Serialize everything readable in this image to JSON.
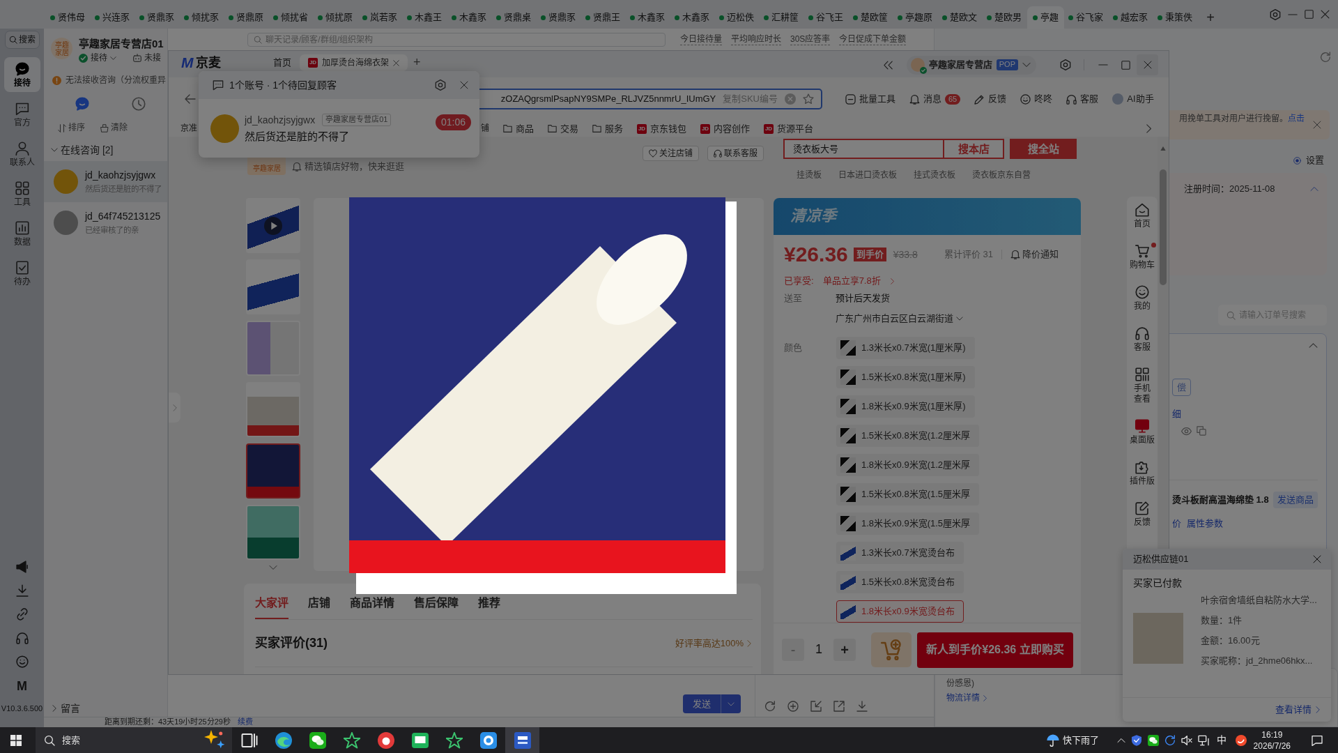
{
  "top_tabs": {
    "tabs": [
      {
        "label": "贤伟母",
        "selected": false
      },
      {
        "label": "兴连豕",
        "selected": false
      },
      {
        "label": "贤鼎豕",
        "selected": false
      },
      {
        "label": "倾扰豕",
        "selected": false
      },
      {
        "label": "贤鼎原",
        "selected": false
      },
      {
        "label": "倾扰省",
        "selected": false
      },
      {
        "label": "倾扰原",
        "selected": false
      },
      {
        "label": "岚若豕",
        "selected": false
      },
      {
        "label": "木鑫王",
        "selected": false
      },
      {
        "label": "木鑫豕",
        "selected": false
      },
      {
        "label": "贤鼎桌",
        "selected": false
      },
      {
        "label": "贤鼎豕",
        "selected": false
      },
      {
        "label": "贤鼎王",
        "selected": false
      },
      {
        "label": "木鑫豕",
        "selected": false
      },
      {
        "label": "木鑫豕",
        "selected": false
      },
      {
        "label": "迈松佚",
        "selected": false
      },
      {
        "label": "汇耕筐",
        "selected": false
      },
      {
        "label": "谷飞王",
        "selected": false
      },
      {
        "label": "楚欧筐",
        "selected": false
      },
      {
        "label": "亭趣原",
        "selected": false
      },
      {
        "label": "楚欧文",
        "selected": false
      },
      {
        "label": "楚欧男",
        "selected": false
      },
      {
        "label": "亭趣",
        "selected": true
      },
      {
        "label": "谷飞家",
        "selected": false
      },
      {
        "label": "越宏豕",
        "selected": false
      },
      {
        "label": "秉策佚",
        "selected": false
      }
    ],
    "new_tab": "+"
  },
  "rail": {
    "search": "搜索",
    "items": [
      {
        "kind": "chat",
        "label": "接待",
        "selected": true
      },
      {
        "kind": "official",
        "label": "官方",
        "selected": false
      },
      {
        "kind": "contacts",
        "label": "联系人",
        "selected": false
      },
      {
        "kind": "tools",
        "label": "工具",
        "selected": false
      },
      {
        "kind": "data",
        "label": "数据",
        "selected": false
      },
      {
        "kind": "todo",
        "label": "待办",
        "selected": false
      }
    ],
    "logo": "M",
    "version": "V10.3.6.500"
  },
  "chat_list": {
    "store_logo": "亭趣家居",
    "store_name": "亭趣家居专营店01",
    "status": "接待",
    "robot_status": "未接",
    "alert": "无法接收咨询（分流权重异",
    "view_tabs": [
      {
        "kind": "chat",
        "selected": true
      },
      {
        "kind": "history",
        "selected": false
      }
    ],
    "sort": "排序",
    "clear": "清除",
    "group": {
      "label": "在线咨询 [2]",
      "expanded": true
    },
    "chats": [
      {
        "name": "jd_kaohzjsyjgwx",
        "preview": "然后货还是脏的不得了",
        "selected": true,
        "online": true
      },
      {
        "name": "jd_64f745213125",
        "preview": "已经审核了的亲",
        "selected": false,
        "online": false
      }
    ],
    "leave_message": "留言"
  },
  "chat_top": {
    "search_placeholder": "聊天记录/顾客/群组/组织架构",
    "stats": [
      "今日接待量",
      "平均响应时长",
      "30S应答率",
      "今日促成下单金额"
    ]
  },
  "composer": {
    "send": "发送"
  },
  "status_strip": {
    "text": "距离到期还剩：43天19小时25分29秒",
    "link": "续费"
  },
  "right_panel": {
    "notice": "用挽单工具对用户进行挽留。",
    "notice_link": "点击",
    "settings": "设置",
    "register_label": "注册时间：",
    "register_date": "2025-11-08",
    "order_search_placeholder": "请输入订单号搜索",
    "order": {
      "tag": "偿",
      "detail_link": "细",
      "product": "烫斗板耐高温海绵垫 1.8",
      "send_product": "发送商品",
      "links": [
        "价",
        "属性参数"
      ]
    },
    "logistics": {
      "text": "份感恩)",
      "link": "物流详情"
    }
  },
  "window": {
    "logo_mark": "M",
    "logo_text": "京麦",
    "tabs": [
      {
        "label": "首页",
        "selected": false
      },
      {
        "label": "加厚烫台海绵衣架",
        "selected": true,
        "icon_text": "JD"
      }
    ],
    "new_tab": "+",
    "store": {
      "name": "亭趣家居专营店",
      "badge": "POP"
    },
    "address": {
      "value": "zOZAQgrsmlPsapNY9SMPe_RLJVZ5nnmrU_IUmGY",
      "copy": "复制SKU编号"
    },
    "tools": [
      {
        "kind": "batch",
        "label": "批量工具"
      },
      {
        "kind": "message",
        "label": "消息",
        "badge": "65"
      },
      {
        "kind": "feedback",
        "label": "反馈"
      },
      {
        "kind": "dongdong",
        "label": "咚咚"
      },
      {
        "kind": "service",
        "label": "客服"
      },
      {
        "kind": "ai",
        "label": "AI助手"
      }
    ],
    "nav": [
      {
        "kind": "plain",
        "label": "京准"
      },
      {
        "kind": "plain",
        "label": "铺"
      },
      {
        "kind": "folder",
        "label": "商品"
      },
      {
        "kind": "folder",
        "label": "交易"
      },
      {
        "kind": "folder",
        "label": "服务"
      },
      {
        "kind": "jd",
        "label": "京东钱包",
        "icon_text": "JD"
      },
      {
        "kind": "jd",
        "label": "内容创作",
        "icon_text": "JD"
      },
      {
        "kind": "jd",
        "label": "货源平台",
        "icon_text": "JD"
      }
    ]
  },
  "product": {
    "store": {
      "logo": "亭趣家居",
      "slogan": "精选镇店好物，快来逛逛",
      "follow": "关注店铺",
      "contact": "联系客服"
    },
    "search": {
      "value": "烫衣板大号",
      "store_button": "搜本店",
      "site_button": "搜全站"
    },
    "hot_words": [
      "挂烫板",
      "日本进口烫衣板",
      "挂式烫衣板",
      "烫衣板京东自营"
    ],
    "thumbnails": [
      {
        "kind": "video",
        "selected": false
      },
      {
        "kind": "photo",
        "selected": false
      },
      {
        "kind": "photo",
        "selected": false
      },
      {
        "kind": "photo",
        "selected": false
      },
      {
        "kind": "photo",
        "selected": true
      },
      {
        "kind": "photo",
        "selected": false
      }
    ],
    "price_panel": {
      "banner": "清凉季",
      "price": "¥26.36",
      "price_tag": "到手价",
      "old_price": "¥33.8",
      "review_count": "累计评价 31",
      "price_alert": "降价通知",
      "discount_label": "已享受:",
      "discount": "单品立享7.8折",
      "ship_label": "送至",
      "ship_note": "预计后天发货",
      "address": "广东广州市白云区白云湖街道",
      "color_label": "颜色",
      "options": [
        {
          "kind": "dark",
          "label": "1.3米长x0.7米宽(1厘米厚)",
          "selected": false
        },
        {
          "kind": "dark",
          "label": "1.5米长x0.8米宽(1厘米厚)",
          "selected": false
        },
        {
          "kind": "dark",
          "label": "1.8米长x0.9米宽(1厘米厚)",
          "selected": false
        },
        {
          "kind": "dark",
          "label": "1.5米长x0.8米宽(1.2厘米厚",
          "selected": false
        },
        {
          "kind": "dark",
          "label": "1.8米长x0.9米宽(1.2厘米厚",
          "selected": false
        },
        {
          "kind": "dark",
          "label": "1.5米长x0.8米宽(1.5厘米厚",
          "selected": false
        },
        {
          "kind": "dark",
          "label": "1.8米长x0.9米宽(1.5厘米厚",
          "selected": false
        },
        {
          "kind": "light",
          "label": "1.3米长x0.7米宽烫台布",
          "selected": false
        },
        {
          "kind": "light",
          "label": "1.5米长x0.8米宽烫台布",
          "selected": false
        },
        {
          "kind": "light",
          "label": "1.8米长x0.9米宽烫台布",
          "selected": true
        }
      ],
      "minus": "-",
      "minus_disabled": true,
      "quantity": "1",
      "plus": "+",
      "buy": "新人到手价¥26.36 立即购买"
    },
    "tabs": [
      {
        "label": "大家评",
        "selected": true
      },
      {
        "label": "店铺",
        "selected": false
      },
      {
        "label": "商品详情",
        "selected": false
      },
      {
        "label": "售后保障",
        "selected": false
      },
      {
        "label": "推荐",
        "selected": false
      }
    ],
    "reviews_title": "买家评价(31)",
    "rating": "好评率高达100%",
    "side_nav": [
      {
        "kind": "home",
        "label": "首页",
        "dot": false,
        "selected": false
      },
      {
        "kind": "cart",
        "label": "购物车",
        "dot": true,
        "selected": false
      },
      {
        "kind": "mine",
        "label": "我的",
        "dot": false,
        "selected": false
      },
      {
        "kind": "service",
        "label": "客服",
        "dot": false,
        "selected": false
      },
      {
        "kind": "qr",
        "label": "手机查看",
        "dot": false,
        "selected": false
      },
      {
        "kind": "desktop",
        "label": "桌面版",
        "dot": false,
        "selected": true
      },
      {
        "kind": "plugin",
        "label": "插件版",
        "dot": false,
        "selected": false
      },
      {
        "kind": "feedback",
        "label": "反馈",
        "dot": false,
        "selected": false
      }
    ]
  },
  "popup": {
    "title": "1个账号 · 1个待回复顾客",
    "user": "jd_kaohzjsyjgwx",
    "store_tag": "亭趣家居专营店01",
    "message": "然后货还是脏的不得了",
    "timer": "01:06"
  },
  "order_toast": {
    "title": "迈松供应链01",
    "status": "买家已付款",
    "product": "叶余宿舍墙纸自粘防水大学...",
    "quantity": "数量：1件",
    "amount": "金额：16.00元",
    "buyer": "买家昵称：jd_2hme06hkx...",
    "details": "查看详情"
  },
  "taskbar": {
    "search_placeholder": "搜索",
    "apps": [
      {
        "kind": "taskview",
        "active": false
      },
      {
        "kind": "browser",
        "active": false
      },
      {
        "kind": "chat",
        "active": false
      },
      {
        "kind": "star",
        "active": false
      },
      {
        "kind": "disc",
        "active": false
      },
      {
        "kind": "message",
        "active": false
      },
      {
        "kind": "star",
        "active": false
      },
      {
        "kind": "tile",
        "active": false
      },
      {
        "kind": "jingmai",
        "active": true
      }
    ],
    "weather": "快下雨了",
    "ime": "中",
    "time": "16:19",
    "date": "2026/7/26"
  }
}
